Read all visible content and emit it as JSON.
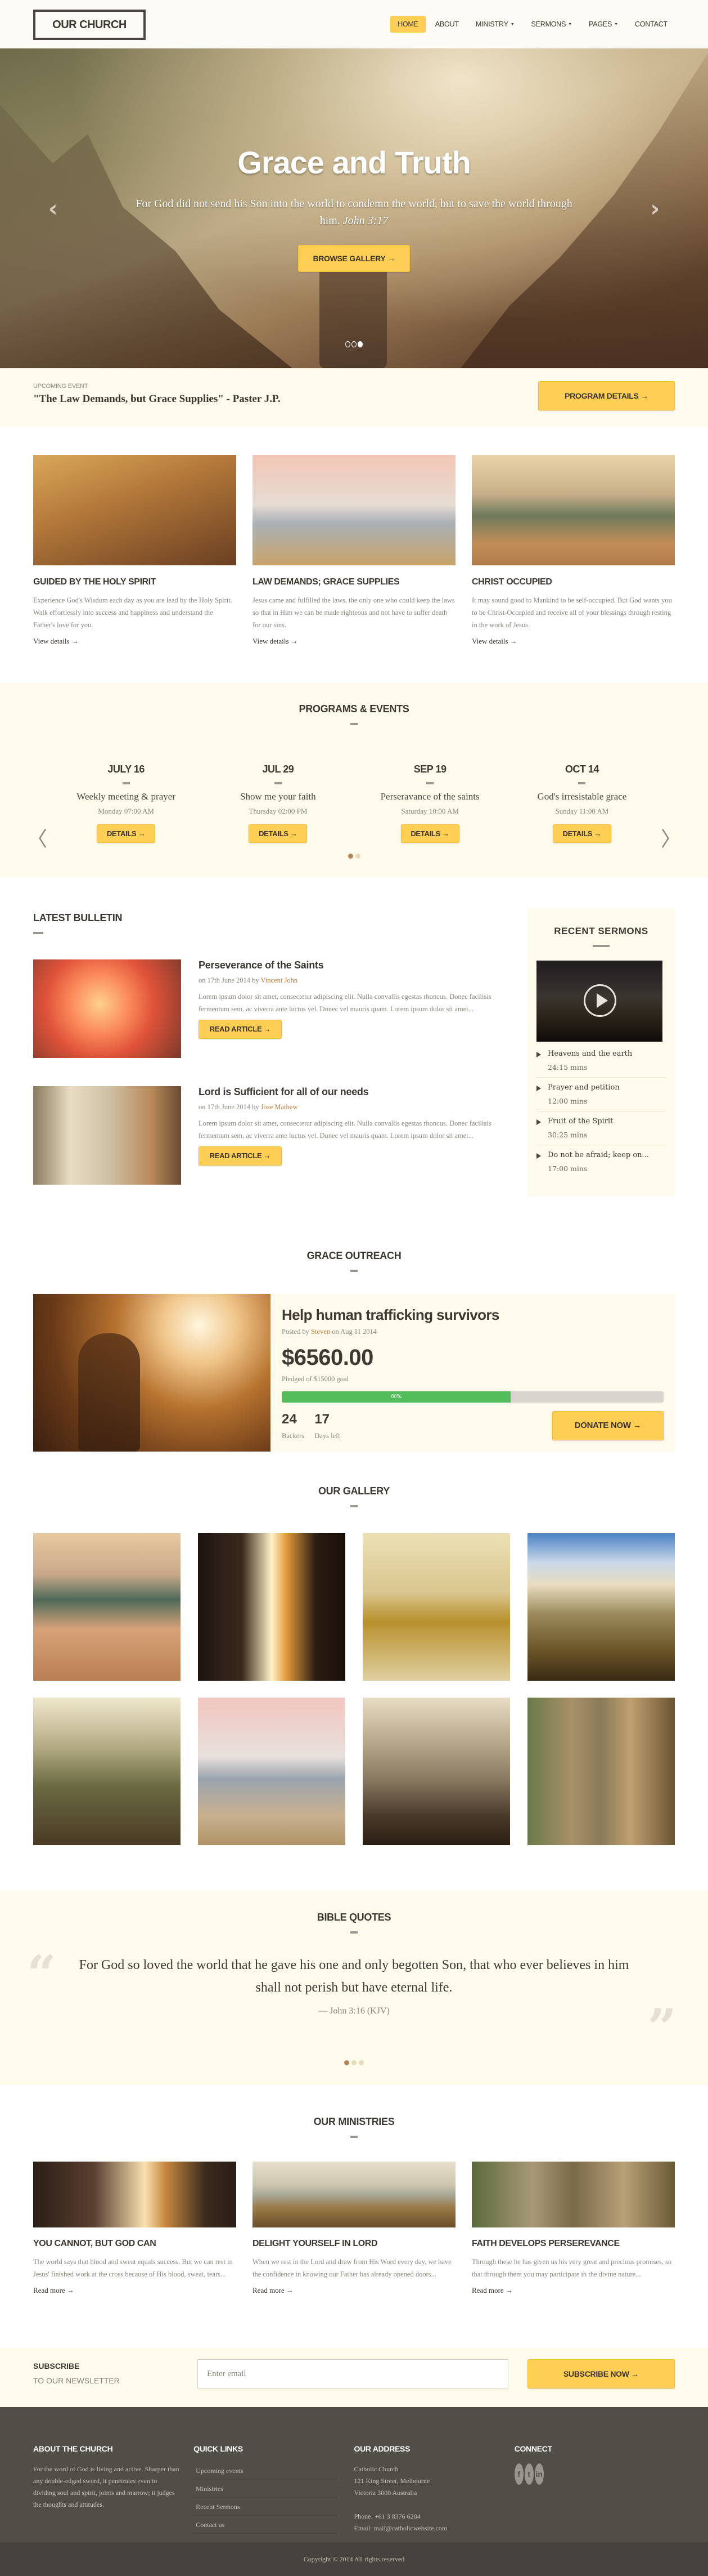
{
  "header": {
    "logo": "OUR CHURCH",
    "nav": [
      {
        "label": "HOME",
        "active": true,
        "dropdown": false
      },
      {
        "label": "ABOUT",
        "active": false,
        "dropdown": false
      },
      {
        "label": "MINISTRY",
        "active": false,
        "dropdown": true
      },
      {
        "label": "SERMONS",
        "active": false,
        "dropdown": true
      },
      {
        "label": "PAGES",
        "active": false,
        "dropdown": true
      },
      {
        "label": "CONTACT",
        "active": false,
        "dropdown": false
      }
    ],
    "caret": "▼"
  },
  "hero": {
    "title": "Grace and Truth",
    "text": "For God did not send his Son into the world to condemn the world, but to save the world through him.",
    "reference": "John 3:17",
    "button": "BROWSE GALLERY →",
    "prev_icon": "‹",
    "next_icon": "›",
    "slides": 3,
    "active_slide": 3
  },
  "upcoming": {
    "label": "UPCOMING EVENT",
    "title": "\"The Law Demands, but Grace Supplies\" - Paster J.P.",
    "button": "PROGRAM DETAILS →"
  },
  "features": [
    {
      "title": "GUIDED BY THE HOLY SPIRIT",
      "text": "Experience God's Wisdom each day as you are lead by the Holy Spirit. Walk effortlessly into success and happiness and understand the Father's love for you.",
      "link": "View details →"
    },
    {
      "title": "LAW DEMANDS; GRACE SUPPLIES",
      "text": "Jesus came and fulfilled the laws, the only one who could keep the laws so that in Him we can be made righteous and not have to suffer death for our sins.",
      "link": "View details →"
    },
    {
      "title": "CHRIST OCCUPIED",
      "text": "It may sound good to Mankind to be self-occupied. But God wants you to be Christ-Occupied and receive all of your blessings through resting in the work of Jesus.",
      "link": "View details →"
    }
  ],
  "programs": {
    "title": "PROGRAMS & EVENTS",
    "prev_icon": "〈",
    "next_icon": "〉",
    "events": [
      {
        "date": "JULY 16",
        "name": "Weekly meeting & prayer",
        "time": "Monday 07:00 AM",
        "button": "DETAILS →"
      },
      {
        "date": "JUL 29",
        "name": "Show me your faith",
        "time": "Thursday 02:00 PM",
        "button": "DETAILS →"
      },
      {
        "date": "SEP 19",
        "name": "Perseravance of the saints",
        "time": "Saturday 10:00 AM",
        "button": "DETAILS →"
      },
      {
        "date": "OCT 14",
        "name": "God's irresistable grace",
        "time": "Sunday 11:00 AM",
        "button": "DETAILS →"
      }
    ],
    "pages": 2,
    "active_page": 1
  },
  "bulletin": {
    "title": "LATEST BULLETIN",
    "articles": [
      {
        "title": "Perseverance of the Saints",
        "meta_prefix": "on 17th June 2014 by ",
        "author": "Vincent John",
        "text": "Lorem ipsum dolor sit amet, consectetur adipiscing elit. Nulla convallis egestas rhoncus. Donec facilisis fermentum sem, ac viverra ante luctus vel. Donec vel mauris quam. Lorem ipsum dolor sit amet...",
        "button": "READ ARTICLE →"
      },
      {
        "title": "Lord is Sufficient for all of our needs",
        "meta_prefix": "on 17th June 2014 by ",
        "author": "Jose Mathew",
        "text": "Lorem ipsum dolor sit amet, consectetur adipiscing elit. Nulla convallis egestas rhoncus. Donec facilisis fermentum sem, ac viverra ante luctus vel. Donec vel mauris quam. Lorem ipsum dolor sit amet...",
        "button": "READ ARTICLE →"
      }
    ]
  },
  "sermons": {
    "title": "RECENT SERMONS",
    "items": [
      {
        "title": "Heavens and the earth",
        "duration": "24:15 mins"
      },
      {
        "title": "Prayer and petition",
        "duration": "12:00 mins"
      },
      {
        "title": "Fruit of the Spirit",
        "duration": "30:25 mins"
      },
      {
        "title": "Do not be afraid; keep on...",
        "duration": "17:00 mins"
      }
    ]
  },
  "outreach": {
    "section_title": "GRACE OUTREACH",
    "title": "Help human trafficking survivors",
    "posted_prefix": "Posted by ",
    "author": "Steven",
    "posted_suffix": " on Aug 11 2014",
    "amount": "$6560.00",
    "goal": "Pledged of $15000 goal",
    "progress_percent": 60,
    "progress_label": "60%",
    "backers": "24",
    "backers_label": "Backers",
    "days_left": "17",
    "days_label": "Days left",
    "button": "DONATE NOW →"
  },
  "gallery": {
    "title": "OUR GALLERY",
    "images": [
      {
        "subject": "man-on-beach-waves"
      },
      {
        "subject": "sunlit-city-street"
      },
      {
        "subject": "couple-on-bench"
      },
      {
        "subject": "swing-by-lake"
      },
      {
        "subject": "hiker-in-mountains"
      },
      {
        "subject": "lifeguard-tower-beach"
      },
      {
        "subject": "bicycle-street"
      },
      {
        "subject": "rock-formations"
      }
    ]
  },
  "quotes": {
    "title": "BIBLE QUOTES",
    "text": "For God so loved the world that he gave his one and only begotten Son, that who ever believes in him shall not perish but have eternal life.",
    "source": "— John 3:16 (KJV)",
    "open_mark": "“",
    "close_mark": "”",
    "pages": 3,
    "active_page": 1
  },
  "ministries": {
    "title": "OUR MINISTRIES",
    "items": [
      {
        "title": "YOU CANNOT, BUT GOD CAN",
        "text": "The world says that blood and sweat equals success. But we can rest in Jesus' finished work at the cross because of His blood, sweat, tears...",
        "link": "Read more →"
      },
      {
        "title": "DELIGHT YOURSELF IN LORD",
        "text": "When we rest in the Lord and draw from His Word every day, we have the confidence in knowing our Father has already opened doors...",
        "link": "Read more →"
      },
      {
        "title": "FAITH DEVELOPS PERSEREVANCE",
        "text": "Through these he has given us his very great and precious promises, so that through them you may participate in the divine nature...",
        "link": "Read more →"
      }
    ]
  },
  "subscribe": {
    "heading": "SUBSCRIBE",
    "subheading": "TO OUR NEWSLETTER",
    "placeholder": "Enter email",
    "button": "SUBSCRIBE NOW →"
  },
  "footer": {
    "about_title": "ABOUT THE CHURCH",
    "about_text": "For the word of God is living and active. Sharper than any double-edged sword, it penetrates even to dividing soul and spirit, joints and marrow; it judges the thoughts and attitudes.",
    "links_title": "QUICK LINKS",
    "links": [
      "Upcoming events",
      "Ministries",
      "Recent Sermons",
      "Contact us"
    ],
    "address_title": "OUR ADDRESS",
    "address": [
      "Catholic Church",
      "121 King Street, Melbourne",
      "Victoria 3000 Australia"
    ],
    "phone": "Phone: +61 3 8376 6284",
    "email": "Email: mail@catholicwebsite.com",
    "connect_title": "CONNECT",
    "social": [
      {
        "name": "facebook",
        "glyph": "f"
      },
      {
        "name": "twitter",
        "glyph": "t"
      },
      {
        "name": "linkedin",
        "glyph": "in"
      }
    ],
    "copyright": "Copyright © 2014 All rights reserved"
  },
  "colors": {
    "accent": "#fecf54",
    "cream": "#fefaec",
    "text_dark": "#3d3832",
    "text_muted": "#8a857e",
    "link_orange": "#c07a3a",
    "progress_green": "#52bb5a",
    "footer_bg": "#514d47"
  }
}
